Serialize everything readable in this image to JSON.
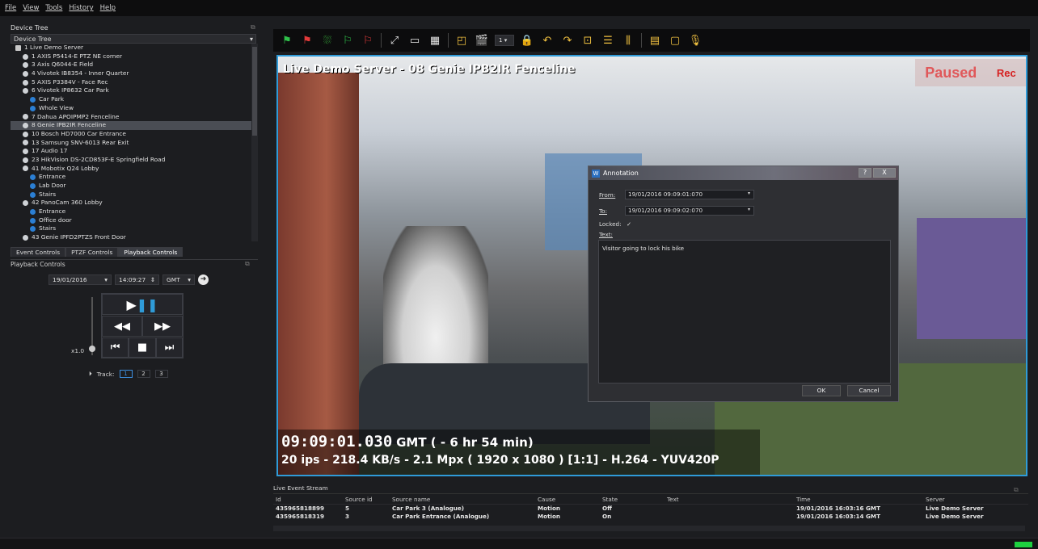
{
  "menu": [
    "File",
    "View",
    "Tools",
    "History",
    "Help"
  ],
  "device_tree": {
    "panel_title": "Device Tree",
    "combo_value": "Device Tree",
    "items": [
      {
        "label": "1 Live Demo Server",
        "icon": "server-icon",
        "level": 0
      },
      {
        "label": "1 AXIS P5414-E PTZ NE corner",
        "icon": "camera-icon",
        "level": 1
      },
      {
        "label": "3 Axis Q6044-E Field",
        "icon": "camera-icon",
        "level": 1
      },
      {
        "label": "4 Vivotek IB8354 - Inner Quarter",
        "icon": "camera-icon",
        "level": 1
      },
      {
        "label": "5 AXIS P3384V - Face Rec",
        "icon": "camera-icon",
        "level": 1
      },
      {
        "label": "6 Vivotek IP8632 Car Park",
        "icon": "camera-icon",
        "level": 1
      },
      {
        "label": "Car Park",
        "icon": "view-icon",
        "level": 2
      },
      {
        "label": "Whole View",
        "icon": "view-icon",
        "level": 2
      },
      {
        "label": "7 Dahua APOIPMP2 Fenceline",
        "icon": "camera-icon",
        "level": 1
      },
      {
        "label": "8 Genie IPB2IR Fenceline",
        "icon": "camera-icon",
        "level": 1,
        "selected": true
      },
      {
        "label": "10 Bosch HD7000 Car Entrance",
        "icon": "camera-icon",
        "level": 1
      },
      {
        "label": "13 Samsung SNV-6013 Rear Exit",
        "icon": "camera-icon",
        "level": 1
      },
      {
        "label": "17 Audio 17",
        "icon": "microphone-icon",
        "level": 1
      },
      {
        "label": "23 HikVision DS-2CD853F-E Springfield Road",
        "icon": "camera-icon",
        "level": 1
      },
      {
        "label": "41 Mobotix Q24 Lobby",
        "icon": "camera-icon",
        "level": 1
      },
      {
        "label": "Entrance",
        "icon": "view-icon",
        "level": 2
      },
      {
        "label": "Lab Door",
        "icon": "view-icon",
        "level": 2
      },
      {
        "label": "Stairs",
        "icon": "view-icon",
        "level": 2
      },
      {
        "label": "42 PanoCam 360 Lobby",
        "icon": "camera-icon",
        "level": 1
      },
      {
        "label": "Entrance",
        "icon": "view-icon",
        "level": 2
      },
      {
        "label": "Office door",
        "icon": "view-icon",
        "level": 2
      },
      {
        "label": "Stairs",
        "icon": "view-icon",
        "level": 2
      },
      {
        "label": "43 Genie IPFD2PTZS Front Door",
        "icon": "camera-icon",
        "level": 1
      }
    ]
  },
  "tabs": [
    "Event Controls",
    "PTZF Controls",
    "Playback Controls"
  ],
  "active_tab": "Playback Controls",
  "playback": {
    "title": "Playback Controls",
    "date": "19/01/2016",
    "time": "14:09:27",
    "timezone": "GMT",
    "speed_label": "x1.0",
    "track_label": "Track:",
    "tracks": [
      "1",
      "2",
      "3"
    ],
    "active_track": "1"
  },
  "toolbar": {
    "icons": [
      "flag-green-icon",
      "flag-red-icon",
      "bookmark-icon",
      "flag-green-step-icon",
      "flag-red-step-icon",
      "fullscreen-icon",
      "monitor-icon",
      "grid-icon",
      "snapshot-icon",
      "clapper-icon",
      "channel-select",
      "lock-icon",
      "undo-icon",
      "redo-icon",
      "export-icon",
      "list-icon",
      "sliders-icon",
      "window-icon",
      "tile-icon",
      "microphone-icon"
    ],
    "channel_value": "1"
  },
  "video": {
    "title": "Live Demo Server - 08 Genie IPB2IR Fenceline",
    "paused": "Paused",
    "rec": "Rec",
    "timestamp": "09:09:01.030",
    "timestamp_rest": "GMT ( - 6 hr 54 min)",
    "stats": "20 ips  -  218.4 KB/s  -  2.1 Mpx  ( 1920 x 1080 ) [1:1] -  H.264  -  YUV420P"
  },
  "annotation": {
    "title": "Annotation",
    "help_btn": "?",
    "close_btn": "X",
    "from_label": "From:",
    "from_value": "19/01/2016 09:09:01:070",
    "to_label": "To:",
    "to_value": "19/01/2016 09:09:02:070",
    "locked_label": "Locked:",
    "locked_value": "✓",
    "text_label": "Text:",
    "text_value": "Visitor going to lock his bike",
    "ok": "OK",
    "cancel": "Cancel"
  },
  "event_stream": {
    "title": "Live Event Stream",
    "columns": [
      "Id",
      "Source id",
      "Source name",
      "Cause",
      "State",
      "Text",
      "Time",
      "Server"
    ],
    "rows": [
      [
        "435965818899",
        "5",
        "Car Park 3 (Analogue)",
        "Motion",
        "Off",
        "",
        "19/01/2016 16:03:16 GMT",
        "Live Demo Server"
      ],
      [
        "435965818319",
        "3",
        "Car Park Entrance (Analogue)",
        "Motion",
        "On",
        "",
        "19/01/2016 16:03:14 GMT",
        "Live Demo Server"
      ]
    ]
  },
  "colors": {
    "accent": "#2f9bd8",
    "paused": "#e0585a",
    "rec": "#d62020",
    "status_led": "#1ed040"
  }
}
